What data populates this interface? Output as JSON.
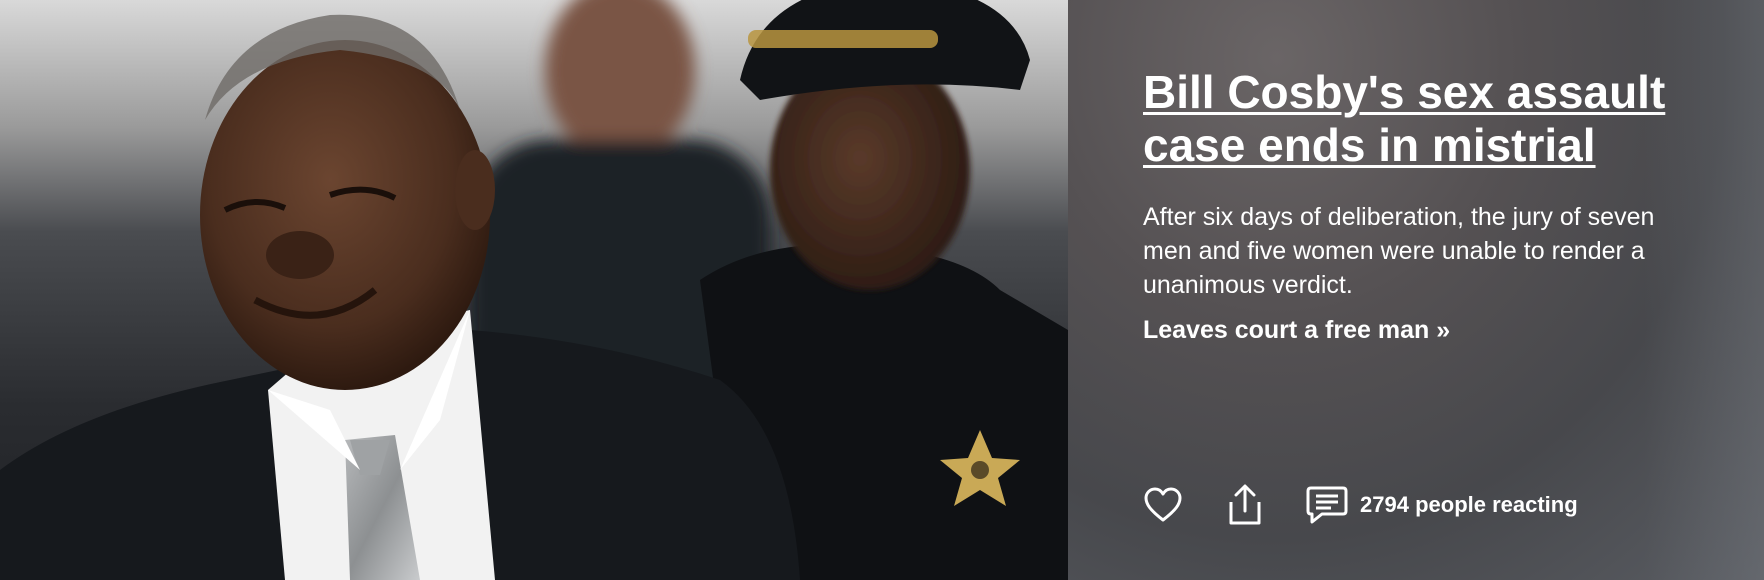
{
  "story": {
    "headline": "Bill Cosby's sex assault case ends in mistrial",
    "summary": "After six days of deliberation, the jury of seven men and five women were unable to render a unanimous verdict.",
    "more_link": "Leaves court a free man »"
  },
  "photo": {
    "subject": "news-photo"
  },
  "actions": {
    "like_icon": "heart-icon",
    "share_icon": "share-icon",
    "comment_icon": "comment-icon",
    "reaction_count": "2794",
    "reaction_suffix": "people reacting"
  },
  "colors": {
    "text": "#ffffff",
    "panel": "#525052"
  }
}
